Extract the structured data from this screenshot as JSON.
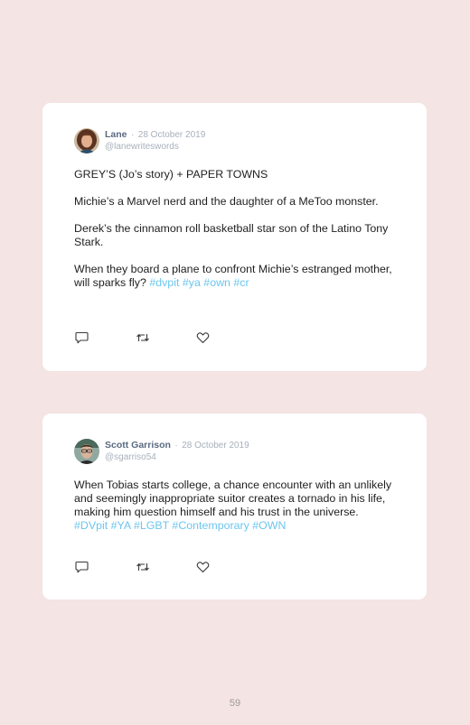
{
  "tweets": [
    {
      "author": "Lane",
      "separator": "·",
      "date": "28 October 2019",
      "handle": "@lanewriteswords",
      "paragraphs": [
        "GREY’S (Jo’s story) + PAPER TOWNS",
        "Michie’s a Marvel nerd and the daughter of a MeToo monster.",
        "Derek’s the cinnamon roll basketball star son of the Latino Tony Stark."
      ],
      "last_paragraph": "When they board a plane to confront Michie’s estranged mother, will sparks fly?",
      "hashtags": [
        "#dvpit",
        "#ya",
        "#own",
        "#cr"
      ],
      "avatar_icon": "avatar-woman-brown-hair-icon"
    },
    {
      "author": "Scott Garrison",
      "separator": "·",
      "date": "28 October 2019",
      "handle": "@sgarriso54",
      "paragraphs": [],
      "last_paragraph": "When Tobias starts college, a chance encounter with an unlikely and seemingly inappropriate suitor creates a tornado in his life, making him question himself and his trust in the universe.",
      "hashtags": [
        "#DVpit",
        "#YA",
        "#LGBT",
        "#Contemporary",
        "#OWN"
      ],
      "avatar_icon": "avatar-man-glasses-icon"
    }
  ],
  "action_icons": [
    "reply-icon",
    "retweet-icon",
    "like-icon"
  ],
  "page_number": "59",
  "colors": {
    "page_background": "#f4e4e4",
    "card_background": "#ffffff",
    "hashtag": "#6cc6ee",
    "name": "#5a6a80",
    "muted": "#a8b0bc"
  }
}
